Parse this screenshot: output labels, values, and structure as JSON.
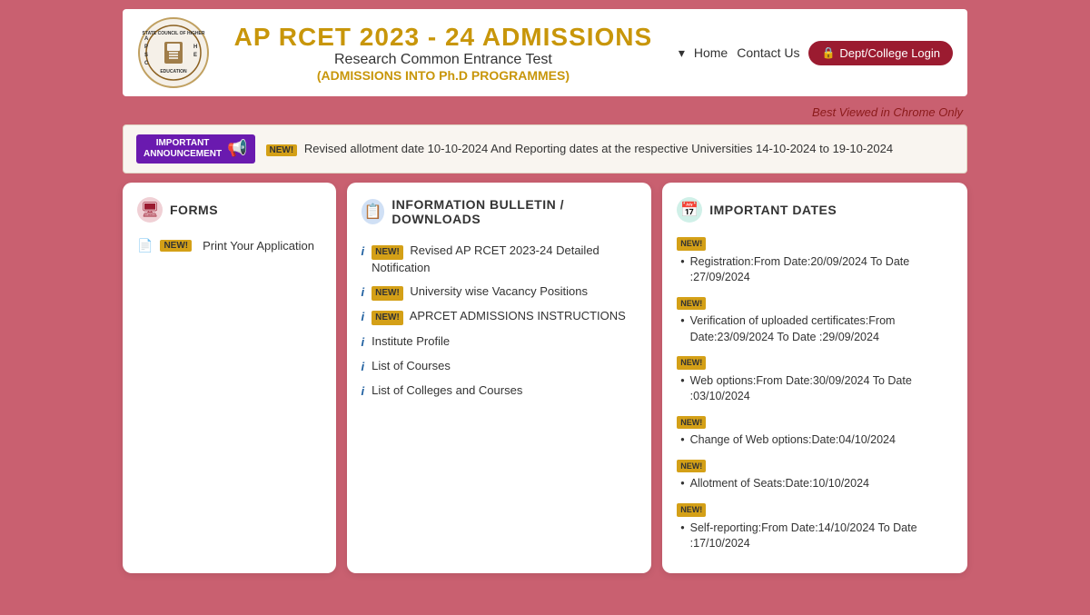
{
  "header": {
    "main_title": "AP RCET 2023 - 24 ADMISSIONS",
    "sub_title": "Research Common Entrance Test",
    "sub_title2": "(ADMISSIONS INTO Ph.D PROGRAMMES)",
    "nav": {
      "dropdown_label": "",
      "home_label": "Home",
      "contact_label": "Contact Us",
      "login_label": "Dept/College Login"
    },
    "best_viewed": "Best Viewed in Chrome Only"
  },
  "announcement": {
    "badge_line1": "IMPORTANT",
    "badge_line2": "ANNOUNCEMENT",
    "text": "Revised allotment date 10-10-2024 And Reporting dates at the respective Universities 14-10-2024 to 19-10-2024"
  },
  "forms": {
    "title": "FORMS",
    "items": [
      {
        "label": "Print Your Application"
      }
    ]
  },
  "info_bulletin": {
    "title": "INFORMATION BULLETIN / DOWNLOADS",
    "items": [
      {
        "label": "Revised AP RCET 2023-24 Detailed Notification"
      },
      {
        "label": "University wise Vacancy Positions"
      },
      {
        "label": "APRCET ADMISSIONS INSTRUCTIONS"
      },
      {
        "label": "Institute Profile"
      },
      {
        "label": "List of Courses"
      },
      {
        "label": "List of Colleges and Courses"
      }
    ]
  },
  "important_dates": {
    "title": "IMPORTANT DATES",
    "items": [
      {
        "text": "Registration:From Date:20/09/2024 To Date :27/09/2024"
      },
      {
        "text": "Verification of uploaded certificates:From Date:23/09/2024 To Date :29/09/2024"
      },
      {
        "text": "Web options:From Date:30/09/2024 To Date :03/10/2024"
      },
      {
        "text": "Change of Web options:Date:04/10/2024"
      },
      {
        "text": "Allotment of Seats:Date:10/10/2024"
      },
      {
        "text": "Self-reporting:From Date:14/10/2024 To Date :17/10/2024"
      }
    ]
  }
}
